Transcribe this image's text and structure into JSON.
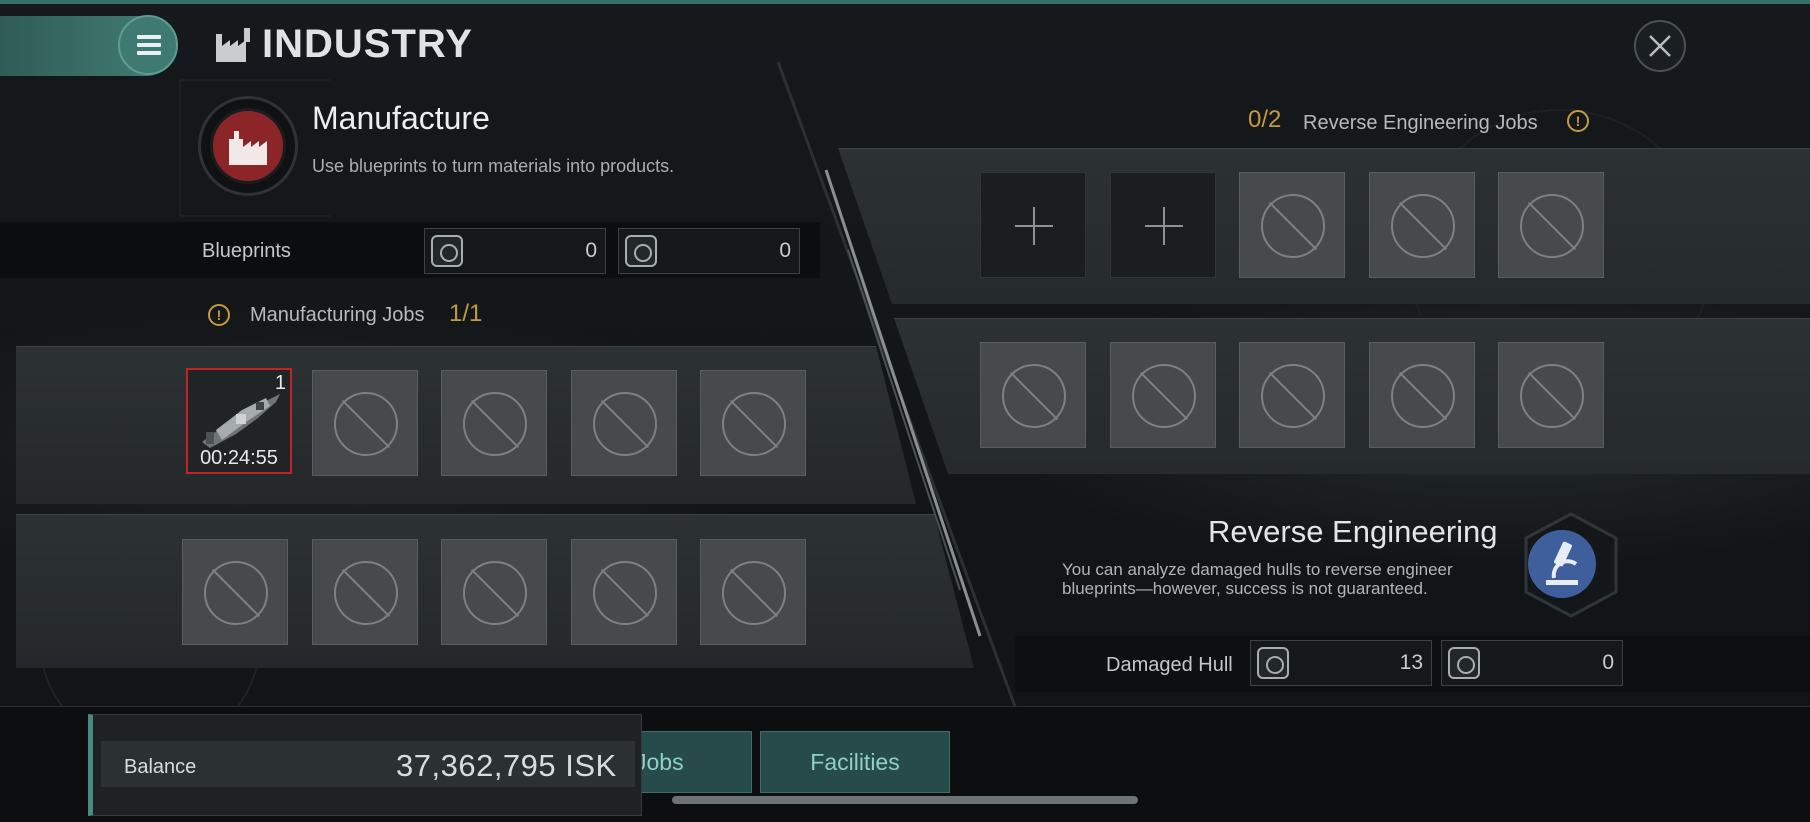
{
  "header": {
    "title": "INDUSTRY",
    "menu_icon": "hamburger-icon",
    "close_icon": "close-icon"
  },
  "manufacture": {
    "title": "Manufacture",
    "description": "Use blueprints to turn materials into products.",
    "blueprints_label": "Blueprints",
    "blueprint_counts": [
      "0",
      "0"
    ],
    "jobs_label": "Manufacturing Jobs",
    "jobs_count": "1/1",
    "active_job": {
      "quantity": "1",
      "timer": "00:24:55"
    }
  },
  "reverse_engineering": {
    "jobs_count": "0/2",
    "jobs_label": "Reverse Engineering Jobs",
    "title": "Reverse Engineering",
    "description": "You can analyze damaged hulls to reverse engineer blueprints—however, success is not guaranteed.",
    "damaged_hull_label": "Damaged Hull",
    "damaged_hull_counts": [
      "13",
      "0"
    ]
  },
  "bottom": {
    "balance_label": "Balance",
    "balance_value": "37,362,795 ISK",
    "tab_jobs_partial": "Jobs",
    "tab_facilities": "Facilities"
  },
  "colors": {
    "accent": "#4b8a80",
    "warning": "#c49a3e",
    "manufacture_red": "#8c2528",
    "active_border": "#c22424"
  }
}
